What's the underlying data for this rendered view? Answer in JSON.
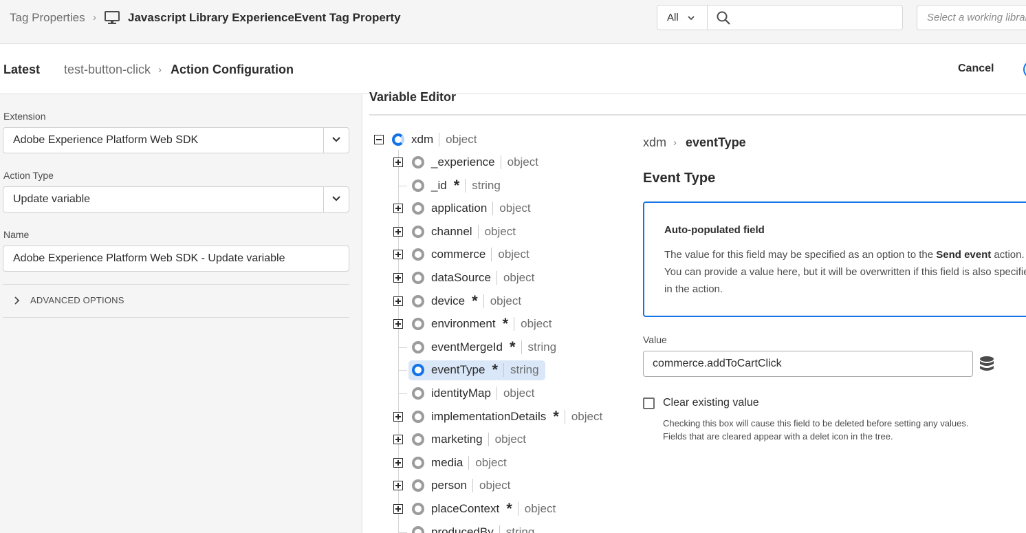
{
  "header": {
    "breadcrumb_root": "Tag Properties",
    "property_title": "Javascript Library ExperienceEvent Tag Property",
    "search_scope": "All",
    "search_placeholder": "",
    "library_placeholder": "Select a working library"
  },
  "subheader": {
    "environment": "Latest",
    "rule_name": "test-button-click",
    "current_page": "Action Configuration",
    "cancel_label": "Cancel"
  },
  "left_panel": {
    "extension_label": "Extension",
    "extension_value": "Adobe Experience Platform Web SDK",
    "action_type_label": "Action Type",
    "action_type_value": "Update variable",
    "name_label": "Name",
    "name_value": "Adobe Experience Platform Web SDK - Update variable",
    "advanced_label": "ADVANCED OPTIONS"
  },
  "editor": {
    "title": "Variable Editor",
    "tree": {
      "root": {
        "name": "xdm",
        "type": "object"
      },
      "nodes": [
        {
          "name": "_experience",
          "type": "object",
          "required": false,
          "expandable": true
        },
        {
          "name": "_id",
          "type": "string",
          "required": true,
          "expandable": false
        },
        {
          "name": "application",
          "type": "object",
          "required": false,
          "expandable": true
        },
        {
          "name": "channel",
          "type": "object",
          "required": false,
          "expandable": true
        },
        {
          "name": "commerce",
          "type": "object",
          "required": false,
          "expandable": true
        },
        {
          "name": "dataSource",
          "type": "object",
          "required": false,
          "expandable": true
        },
        {
          "name": "device",
          "type": "object",
          "required": true,
          "expandable": true
        },
        {
          "name": "environment",
          "type": "object",
          "required": true,
          "expandable": true
        },
        {
          "name": "eventMergeId",
          "type": "string",
          "required": true,
          "expandable": false
        },
        {
          "name": "eventType",
          "type": "string",
          "required": true,
          "expandable": false,
          "selected": true
        },
        {
          "name": "identityMap",
          "type": "object",
          "required": false,
          "expandable": false
        },
        {
          "name": "implementationDetails",
          "type": "object",
          "required": true,
          "expandable": true
        },
        {
          "name": "marketing",
          "type": "object",
          "required": false,
          "expandable": true
        },
        {
          "name": "media",
          "type": "object",
          "required": false,
          "expandable": true
        },
        {
          "name": "person",
          "type": "object",
          "required": false,
          "expandable": true
        },
        {
          "name": "placeContext",
          "type": "object",
          "required": true,
          "expandable": true
        },
        {
          "name": "producedBy",
          "type": "string",
          "required": false,
          "expandable": false
        }
      ]
    },
    "required_marker": "*"
  },
  "detail": {
    "crumb_root": "xdm",
    "crumb_leaf": "eventType",
    "title": "Event Type",
    "info_heading": "Auto-populated field",
    "info_line1_prefix": "The value for this field may be specified as an option to the ",
    "info_line1_bold": "Send event",
    "info_line1_suffix": " action.",
    "info_line2": "You can provide a value here, but it will be overwritten if this field is also specified",
    "info_line3": "in the action.",
    "value_label": "Value",
    "value": "commerce.addToCartClick",
    "clear_label": "Clear existing value",
    "help_line1": "Checking this box will cause this field to be deleted before setting any values.",
    "help_line2": "Fields that are cleared appear with a delet icon in the tree."
  },
  "colors": {
    "accent": "#1473e6",
    "selected_row": "#d9e7f8",
    "panel_bg": "#f5f5f5"
  }
}
